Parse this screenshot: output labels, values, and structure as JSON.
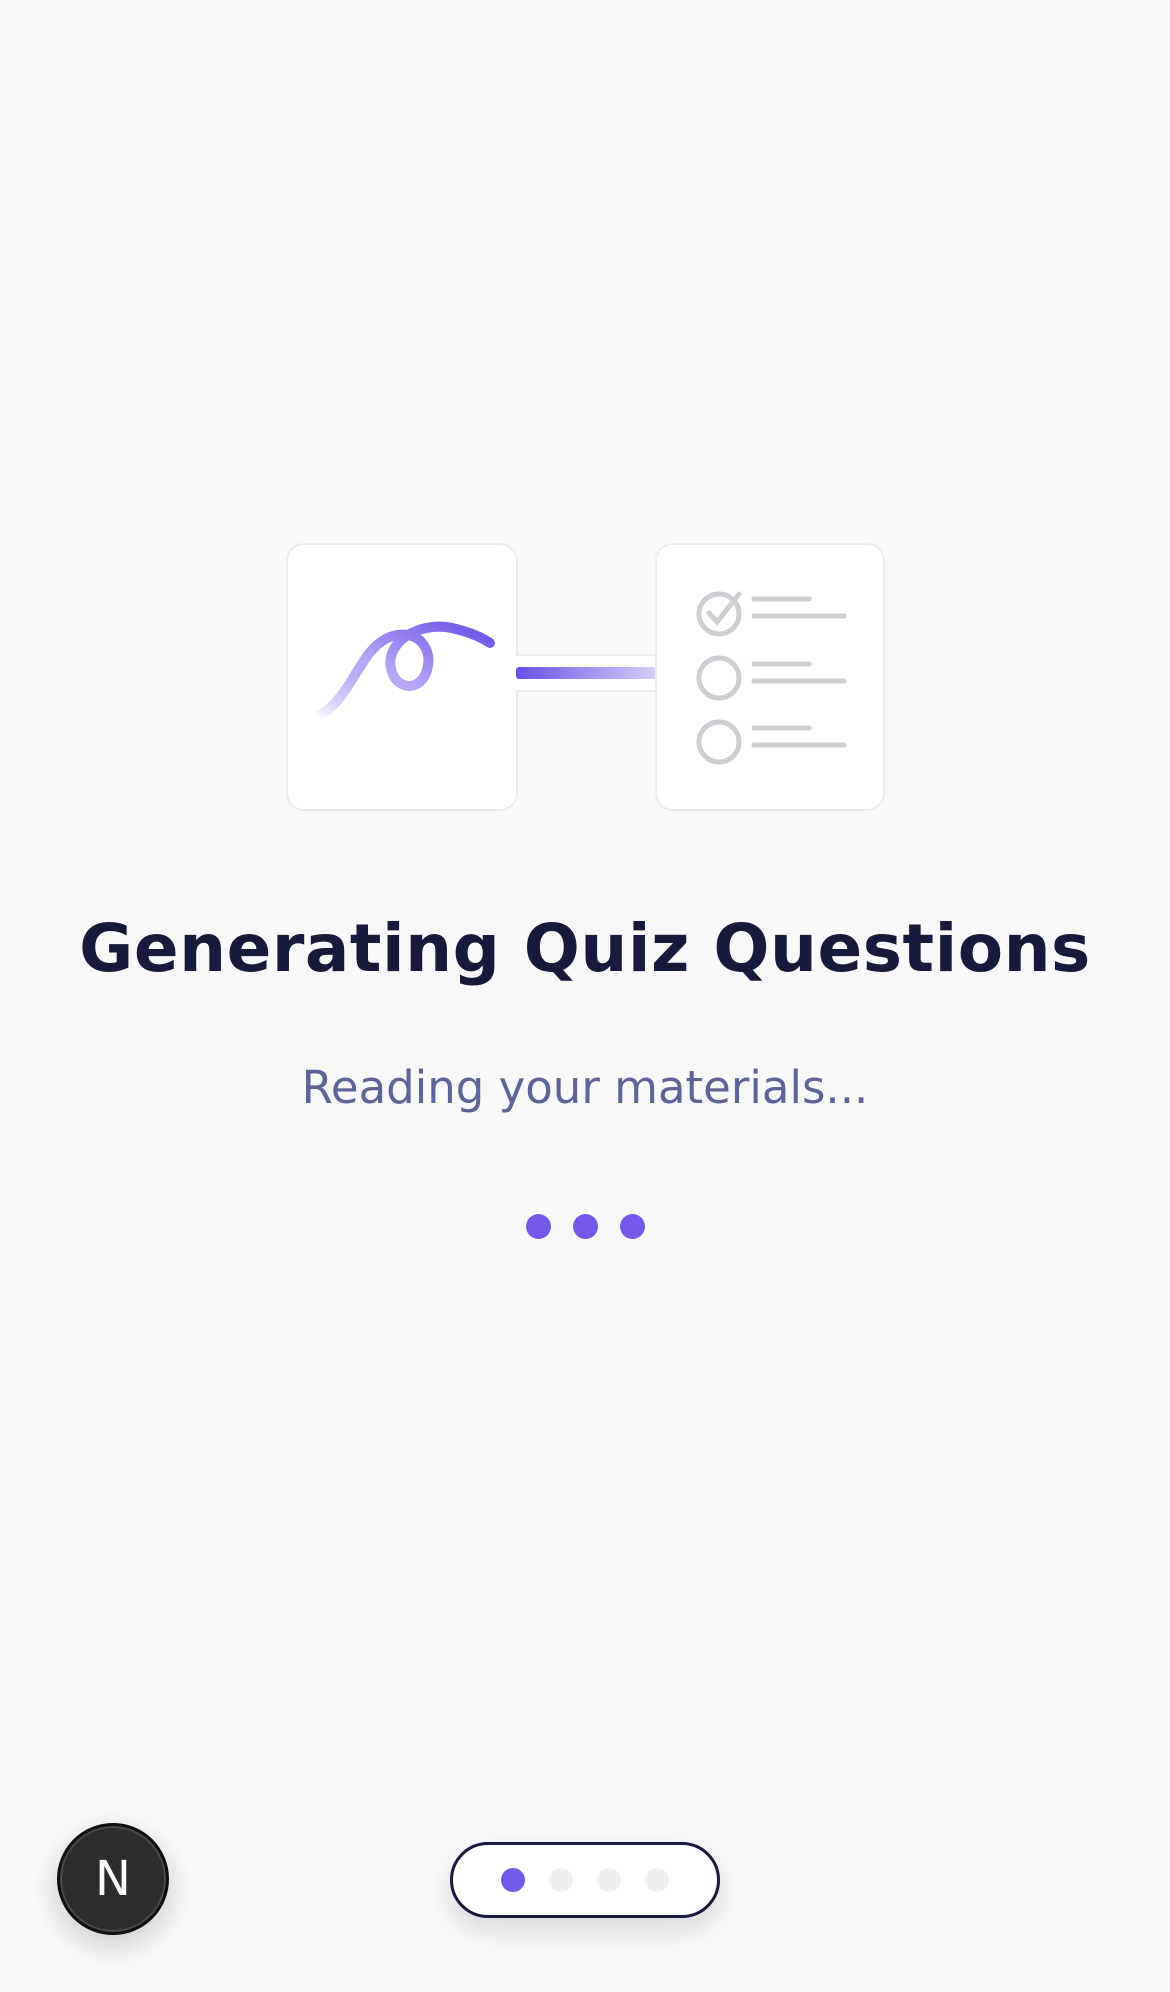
{
  "illustration": {
    "source_icon": "squiggle-icon",
    "quiz_icon": "checklist-icon",
    "connector_icon": "progress-connector"
  },
  "title": "Generating Quiz Questions",
  "subtitle": "Reading your materials...",
  "loading_indicator": {
    "dot_count": 3,
    "color": "#7358ea"
  },
  "next_button": {
    "label": "N"
  },
  "pager": {
    "page_count": 4,
    "active_index": 0,
    "active_color": "#7358ea",
    "inactive_color": "#efeff1"
  },
  "colors": {
    "accent": "#7358ea",
    "title": "#171a3a",
    "subtitle": "#5d6497",
    "background": "#f8f8f8"
  }
}
